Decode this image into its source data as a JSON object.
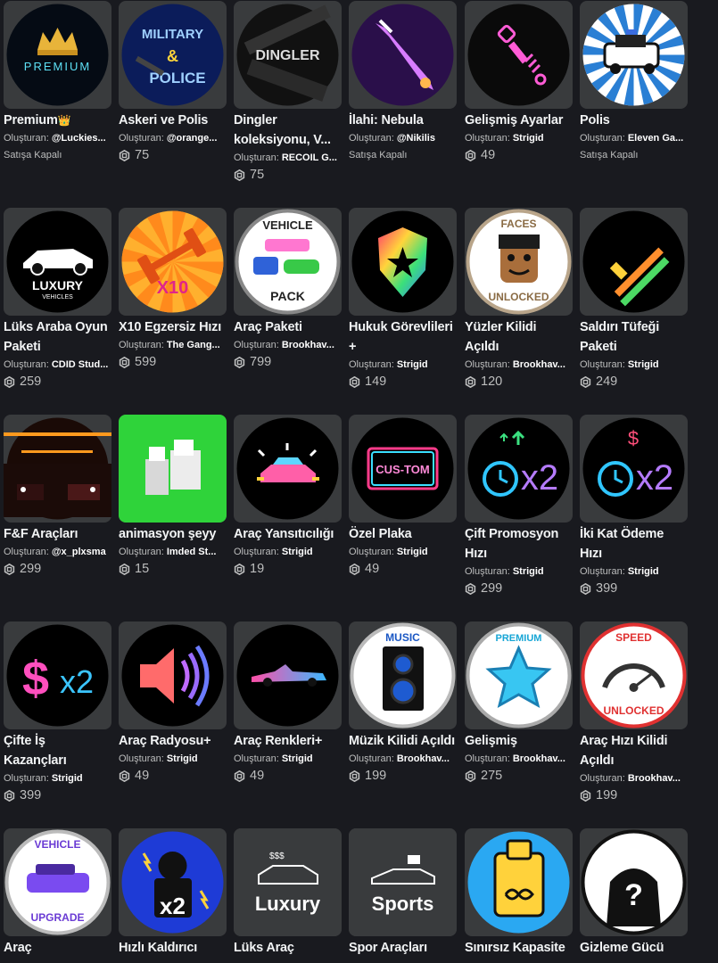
{
  "creator_prefix": "Oluşturan:",
  "offsale_label": "Satışa Kapalı",
  "items": [
    {
      "title": "Premium",
      "crown": "👑",
      "creator": "@Luckies...",
      "price": null,
      "icon": "premium-crown-icon"
    },
    {
      "title": "Askeri ve Polis",
      "creator": "@orange...",
      "price": "75",
      "icon": "military-police-icon"
    },
    {
      "title": "Dingler koleksiyonu, V...",
      "creator": "RECOIL G...",
      "price": "75",
      "icon": "dingler-icon"
    },
    {
      "title": "İlahi: Nebula",
      "creator": "@Nikilis",
      "price": null,
      "icon": "nebula-sword-icon"
    },
    {
      "title": "Gelişmiş Ayarlar",
      "creator": "Strigid",
      "price": "49",
      "icon": "suspension-icon"
    },
    {
      "title": "Polis",
      "creator": "Eleven Ga...",
      "price": null,
      "icon": "police-car-icon"
    },
    {
      "title": "Lüks Araba Oyun Paketi",
      "creator": "CDID Stud...",
      "price": "259",
      "icon": "luxury-car-icon"
    },
    {
      "title": "X10 Egzersiz Hızı",
      "creator": "The Gang...",
      "price": "599",
      "icon": "dumbbell-icon"
    },
    {
      "title": "Araç Paketi",
      "creator": "Brookhav...",
      "price": "799",
      "icon": "vehicle-pack-icon"
    },
    {
      "title": "Hukuk Görevlileri +",
      "creator": "Strigid",
      "price": "149",
      "icon": "badge-icon"
    },
    {
      "title": "Yüzler Kilidi Açıldı",
      "creator": "Brookhav...",
      "price": "120",
      "icon": "faces-unlocked-icon"
    },
    {
      "title": "Saldırı Tüfeği Paketi",
      "creator": "Strigid",
      "price": "249",
      "icon": "rifles-icon"
    },
    {
      "title": "F&F Araçları",
      "creator": "@x_plxsma",
      "price": "299",
      "icon": "garage-icon"
    },
    {
      "title": "animasyon şeyy",
      "creator": "Imded St...",
      "price": "15",
      "icon": "animation-icon"
    },
    {
      "title": "Araç Yansıtıcılığı",
      "creator": "Strigid",
      "price": "19",
      "icon": "reflective-car-icon"
    },
    {
      "title": "Özel Plaka",
      "creator": "Strigid",
      "price": "49",
      "icon": "custom-plate-icon"
    },
    {
      "title": "Çift Promosyon Hızı",
      "creator": "Strigid",
      "price": "299",
      "icon": "clock-x2-up-icon"
    },
    {
      "title": "İki Kat Ödeme Hızı",
      "creator": "Strigid",
      "price": "399",
      "icon": "clock-x2-dollar-icon"
    },
    {
      "title": "Çifte İş Kazançları",
      "creator": "Strigid",
      "price": "399",
      "icon": "dollar-x2-icon"
    },
    {
      "title": "Araç Radyosu+",
      "creator": "Strigid",
      "price": "49",
      "icon": "speaker-icon"
    },
    {
      "title": "Araç Renkleri+",
      "creator": "Strigid",
      "price": "49",
      "icon": "convertible-icon"
    },
    {
      "title": "Müzik Kilidi Açıldı",
      "creator": "Brookhav...",
      "price": "199",
      "icon": "music-speaker-icon"
    },
    {
      "title": "Gelişmiş",
      "creator": "Brookhav...",
      "price": "275",
      "icon": "premium-star-icon"
    },
    {
      "title": "Araç Hızı Kilidi Açıldı",
      "creator": "Brookhav...",
      "price": "199",
      "icon": "speedometer-icon"
    },
    {
      "title": "Araç",
      "creator": "",
      "price": null,
      "icon": "vehicle-upgrade-icon",
      "hide_offsale": true
    },
    {
      "title": "Hızlı Kaldırıcı",
      "creator": "",
      "price": null,
      "icon": "lifter-x2-icon",
      "hide_offsale": true
    },
    {
      "title": "Lüks Araç",
      "creator": "",
      "price": null,
      "icon": "luxury-label-icon",
      "hide_offsale": true
    },
    {
      "title": "Spor Araçları",
      "creator": "",
      "price": null,
      "icon": "sports-label-icon",
      "hide_offsale": true
    },
    {
      "title": "Sınırsız Kapasite",
      "creator": "",
      "price": null,
      "icon": "infinite-capacity-icon",
      "hide_offsale": true
    },
    {
      "title": "Gizleme Gücü",
      "creator": "",
      "price": null,
      "icon": "hidden-avatar-icon",
      "hide_offsale": true
    }
  ],
  "thumb_texts": {
    "premium": "PREMIUM",
    "military": "MILITARY",
    "amp": "&",
    "police": "POLICE",
    "dingler": "DINGLER",
    "luxury": "LUXURY",
    "vehicles": "VEHICLES",
    "x10": "X10",
    "vehicle": "VEHICLE",
    "pack": "PACK",
    "faces": "FACES",
    "unlocked": "UNLOCKED",
    "custom": "CUS-TOM",
    "x2": "x2",
    "dollar": "$",
    "music": "MUSIC",
    "premium2": "PREMIUM",
    "speed": "SPEED",
    "vehicle2": "VEHICLE",
    "upgrade": "UPGRADE",
    "luxury2": "Luxury",
    "sports": "Sports",
    "dollars3": "$$$"
  },
  "colors": {
    "bg": "#191a1f",
    "card": "#393b3d",
    "text": "#f2f4f5",
    "muted": "#bdbebe"
  }
}
